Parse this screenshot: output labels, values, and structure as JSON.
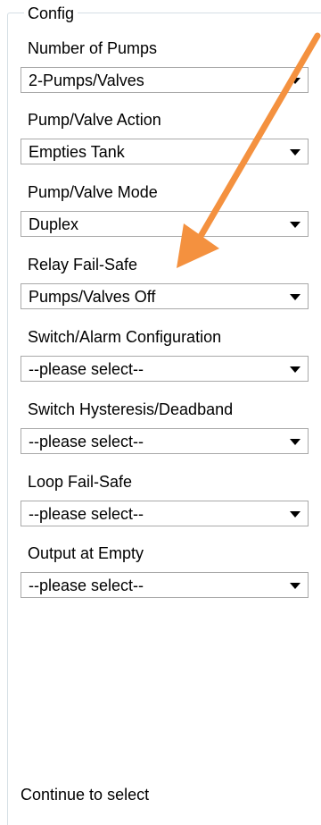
{
  "group": {
    "legend": "Config",
    "fields": [
      {
        "label": "Number of Pumps",
        "value": "2-Pumps/Valves"
      },
      {
        "label": "Pump/Valve Action",
        "value": "Empties Tank"
      },
      {
        "label": "Pump/Valve Mode",
        "value": "Duplex"
      },
      {
        "label": "Relay Fail-Safe",
        "value": "Pumps/Valves Off"
      },
      {
        "label": "Switch/Alarm Configuration",
        "value": "--please select--"
      },
      {
        "label": "Switch Hysteresis/Deadband",
        "value": "--please select--"
      },
      {
        "label": "Loop Fail-Safe",
        "value": "--please select--"
      },
      {
        "label": "Output at Empty",
        "value": "--please select--"
      }
    ],
    "footer": "Continue to select"
  },
  "annotation": {
    "arrow_color": "#f4913f",
    "arrow_icon": "orange-pointer-arrow"
  }
}
